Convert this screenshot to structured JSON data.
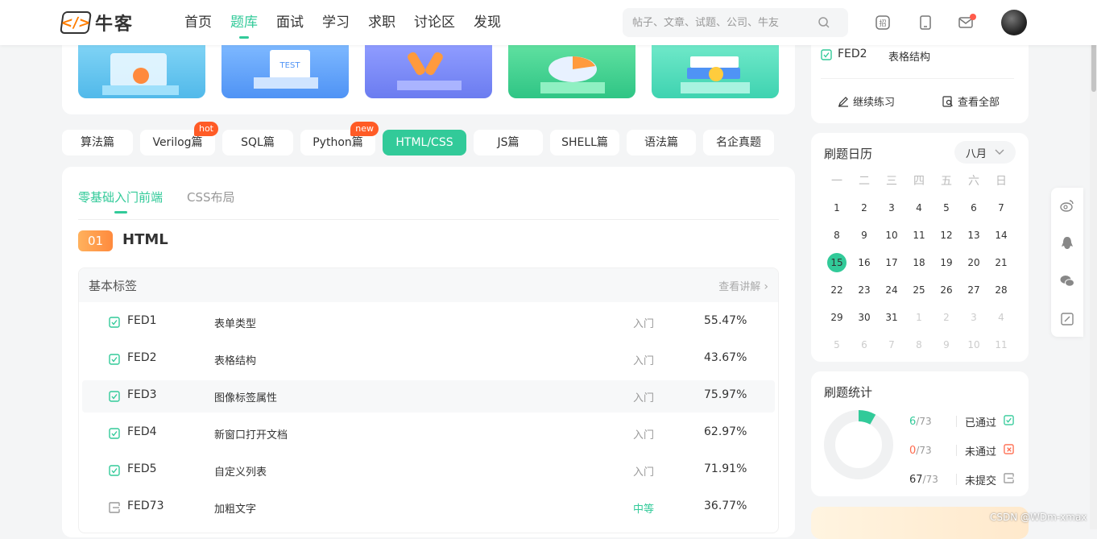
{
  "header": {
    "logo_text": "牛客",
    "nav": [
      "首页",
      "题库",
      "面试",
      "学习",
      "求职",
      "讨论区",
      "发现"
    ],
    "active_nav": "题库",
    "search_placeholder": "帖子、文章、试题、公司、牛友"
  },
  "tags": [
    {
      "label": "算法篇",
      "badge": ""
    },
    {
      "label": "Verilog篇",
      "badge": "hot"
    },
    {
      "label": "SQL篇",
      "badge": ""
    },
    {
      "label": "Python篇",
      "badge": "new"
    },
    {
      "label": "HTML/CSS",
      "badge": "",
      "active": true
    },
    {
      "label": "JS篇",
      "badge": ""
    },
    {
      "label": "SHELL篇",
      "badge": ""
    },
    {
      "label": "语法篇",
      "badge": ""
    },
    {
      "label": "名企真题",
      "badge": ""
    }
  ],
  "subtabs": [
    "零基础入门前端",
    "CSS布局"
  ],
  "section": {
    "number": "01",
    "title": "HTML"
  },
  "list": {
    "title": "基本标签",
    "view_detail": "查看讲解",
    "rows": [
      {
        "id": "FED1",
        "name": "表单类型",
        "level": "入门",
        "pct": "55.47%",
        "status": "passed"
      },
      {
        "id": "FED2",
        "name": "表格结构",
        "level": "入门",
        "pct": "43.67%",
        "status": "passed"
      },
      {
        "id": "FED3",
        "name": "图像标签属性",
        "level": "入门",
        "pct": "75.97%",
        "status": "passed"
      },
      {
        "id": "FED4",
        "name": "新窗口打开文档",
        "level": "入门",
        "pct": "62.97%",
        "status": "passed"
      },
      {
        "id": "FED5",
        "name": "自定义列表",
        "level": "入门",
        "pct": "71.91%",
        "status": "passed"
      },
      {
        "id": "FED73",
        "name": "加粗文字",
        "level": "中等",
        "pct": "36.77%",
        "status": "unsubmitted"
      }
    ]
  },
  "recent": {
    "id": "FED2",
    "name": "表格结构",
    "continue_label": "继续练习",
    "view_all_label": "查看全部"
  },
  "calendar": {
    "title": "刷题日历",
    "month": "八月",
    "weekdays": [
      "一",
      "二",
      "三",
      "四",
      "五",
      "六",
      "日"
    ],
    "today": "15",
    "weeks": [
      [
        "1",
        "2",
        "3",
        "4",
        "5",
        "6",
        "7"
      ],
      [
        "8",
        "9",
        "10",
        "11",
        "12",
        "13",
        "14"
      ],
      [
        "15",
        "16",
        "17",
        "18",
        "19",
        "20",
        "21"
      ],
      [
        "22",
        "23",
        "24",
        "25",
        "26",
        "27",
        "28"
      ],
      [
        "29",
        "30",
        "31",
        "1",
        "2",
        "3",
        "4"
      ],
      [
        "5",
        "6",
        "7",
        "8",
        "9",
        "10",
        "11"
      ]
    ]
  },
  "stats": {
    "title": "刷题统计",
    "items": [
      {
        "count": "6",
        "total": "/73",
        "label": "已通过",
        "color": "#32ca99"
      },
      {
        "count": "0",
        "total": "/73",
        "label": "未通过",
        "color": "#ff6a4d"
      },
      {
        "count": "67",
        "total": "/73",
        "label": "未提交",
        "color": "#333333"
      }
    ],
    "passed_fraction": 0.082
  },
  "watermark": "CSDN @WDm-xmax",
  "colors": {
    "accent": "#32ca99",
    "badge": "#ff5b26"
  }
}
